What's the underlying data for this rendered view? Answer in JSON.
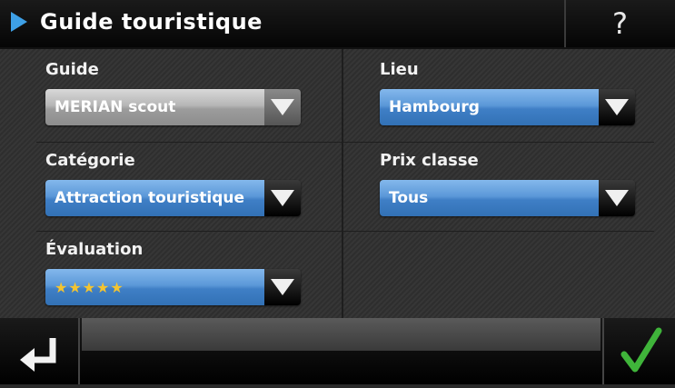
{
  "header": {
    "title": "Guide touristique",
    "help_label": "?",
    "icons": {
      "title_arrow": "play-arrow-icon"
    }
  },
  "form": {
    "guide": {
      "label": "Guide",
      "value": "MERIAN scout",
      "enabled": false
    },
    "lieu": {
      "label": "Lieu",
      "value": "Hambourg"
    },
    "categorie": {
      "label": "Catégorie",
      "value": "Attraction touristique"
    },
    "prix_classe": {
      "label": "Prix classe",
      "value": "Tous"
    },
    "evaluation": {
      "label": "Évaluation",
      "value": "★★★★★",
      "rating": 5,
      "max": 5
    }
  },
  "footer": {
    "icons": {
      "back": "return-arrow-icon",
      "confirm": "checkmark-icon"
    }
  },
  "colors": {
    "accent": "#3ea0e6",
    "select_blue": "#5b98d8",
    "confirm_green": "#3fb43a",
    "star": "#f4c430"
  }
}
